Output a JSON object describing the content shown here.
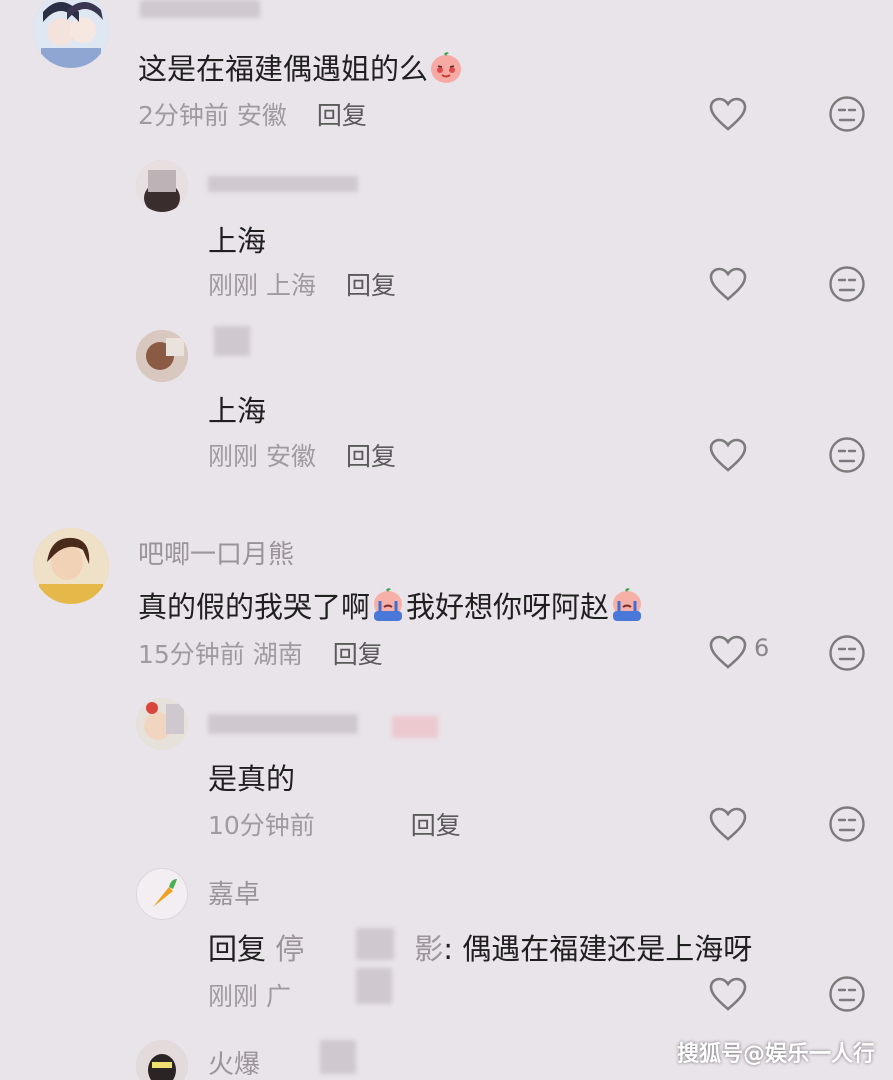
{
  "comments": [
    {
      "name": "",
      "text": "这是在福建偶遇姐的么",
      "time": "2分钟前",
      "location": "安徽",
      "reply": "回复"
    },
    {
      "name": "",
      "text": "上海",
      "time": "刚刚",
      "location": "上海",
      "reply": "回复"
    },
    {
      "name": "",
      "text": "上海",
      "time": "刚刚",
      "location": "安徽",
      "reply": "回复"
    },
    {
      "name": "吧唧一口月熊",
      "text_a": "真的假的我哭了啊",
      "text_b": "我好想你呀阿赵",
      "time": "15分钟前",
      "location": "湖南",
      "reply": "回复",
      "likes": "6"
    },
    {
      "name": "",
      "text": "是真的",
      "time": "10分钟前",
      "location": "",
      "reply": "回复"
    },
    {
      "name": "嘉卓",
      "reply_prefix": "回复",
      "reply_to": "停",
      "reply_to_end": "影",
      "text": ": 偶遇在福建还是上海呀",
      "time": "刚刚",
      "location": "广",
      "reply": ""
    },
    {
      "name": "火爆"
    }
  ],
  "watermark": "搜狐号@娱乐一人行",
  "icons": {
    "like": "heart-icon",
    "dislike": "neutral-face-icon",
    "emoji_blush": "blushing-face-emoji",
    "emoji_cry": "crying-face-emoji",
    "carrot": "carrot-icon"
  }
}
